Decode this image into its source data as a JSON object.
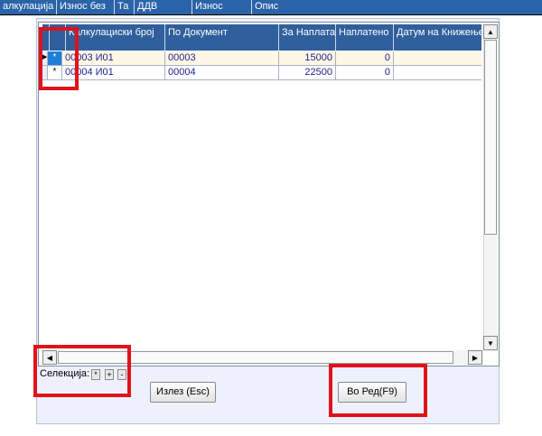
{
  "background_header": {
    "columns": [
      "алкулација",
      "Износ без",
      "Та",
      "ДДВ",
      "Износ",
      "Опис"
    ]
  },
  "grid": {
    "columns": [
      "",
      "Калкулациски број",
      "По Документ",
      "За Наплата",
      "Наплатено",
      "Датум на Книжење"
    ],
    "rows": [
      {
        "check": "*",
        "kalk": "00003  И01",
        "doc": "00003",
        "za_naplata": "15000",
        "naplateno": "0",
        "datum": "",
        "selected": true
      },
      {
        "check": "*",
        "kalk": "00004  И01",
        "doc": "00004",
        "za_naplata": "22500",
        "naplateno": "0",
        "datum": "",
        "selected": false
      }
    ]
  },
  "selection": {
    "label": "Селекција:",
    "buttons": [
      "*",
      "+",
      "-"
    ]
  },
  "buttons": {
    "exit": "Излез (Esc)",
    "ok": "Во Ред(F9)"
  },
  "colors": {
    "header_blue": "#2f5f9c",
    "selection_blue": "#1f7fd6",
    "row_text": "#1b1f8a",
    "highlight_red": "#e0121a"
  }
}
